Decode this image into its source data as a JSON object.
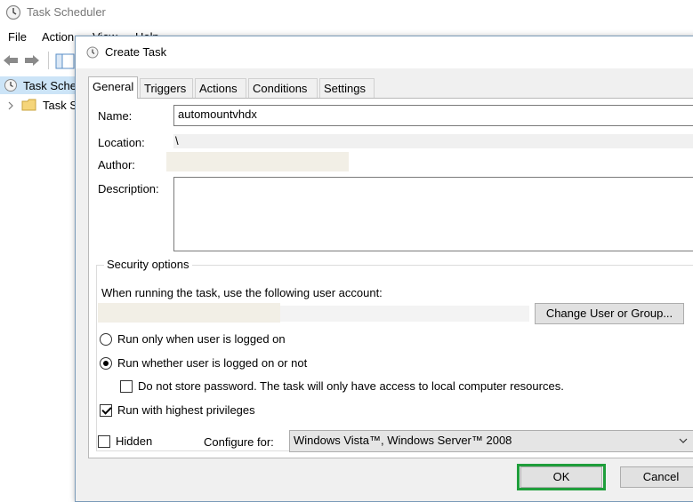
{
  "app": {
    "title": "Task Scheduler",
    "menu": [
      "File",
      "Action",
      "View",
      "Help"
    ],
    "tree": [
      {
        "label": "Task Sche",
        "selected": true
      },
      {
        "label": "Task S",
        "selected": false
      }
    ]
  },
  "dialog": {
    "title": "Create Task",
    "tabs": [
      "General",
      "Triggers",
      "Actions",
      "Conditions",
      "Settings"
    ],
    "active_tab": "General",
    "general": {
      "name_label": "Name:",
      "name_value": "automountvhdx",
      "location_label": "Location:",
      "location_value": "\\",
      "author_label": "Author:",
      "description_label": "Description:",
      "security": {
        "title": "Security options",
        "account_prompt": "When running the task, use the following user account:",
        "change_user_button": "Change User or Group...",
        "radio_logged_on": "Run only when user is logged on",
        "radio_whether": "Run whether user is logged on or not",
        "selected_radio": "Run whether user is logged on or not",
        "do_not_store": "Do not store password.  The task will only have access to local computer resources.",
        "do_not_store_checked": false,
        "highest_privileges": "Run with highest privileges",
        "highest_privileges_checked": true
      },
      "hidden_label": "Hidden",
      "hidden_checked": false,
      "configure_label": "Configure for:",
      "configure_value": "Windows Vista™, Windows Server™ 2008"
    },
    "ok_button": "OK",
    "cancel_button": "Cancel",
    "highlight_color": "#1f9e3b"
  }
}
